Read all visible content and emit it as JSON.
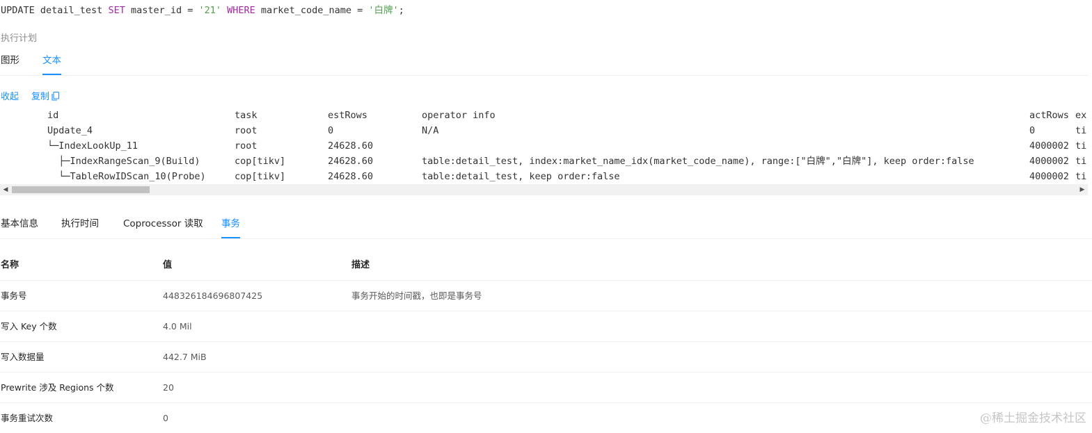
{
  "sql": {
    "p1": "UPDATE detail_test ",
    "kw_set": "SET",
    "p2": " master_id = ",
    "s1": "'21'",
    "p3": " ",
    "kw_where": "WHERE",
    "p4": " market_code_name = ",
    "s2": "'白牌'",
    "p5": ";"
  },
  "plan_section_label": "执行计划",
  "view_tabs": [
    {
      "label": "图形",
      "active": false
    },
    {
      "label": "文本",
      "active": true
    }
  ],
  "actions": {
    "collapse": "收起",
    "copy": "复制",
    "copy_icon": "copy-icon"
  },
  "plan": {
    "columns": [
      "id",
      "task",
      "estRows",
      "operator info",
      "actRows",
      "ex"
    ],
    "rows": [
      {
        "id": "Update_4",
        "task": "root",
        "estRows": "0",
        "info": "N/A",
        "actRows": "0",
        "ex": "ti"
      },
      {
        "id": "└─IndexLookUp_11",
        "task": "root",
        "estRows": "24628.60",
        "info": "",
        "actRows": "4000002",
        "ex": "ti"
      },
      {
        "id": "  ├─IndexRangeScan_9(Build)",
        "task": "cop[tikv]",
        "estRows": "24628.60",
        "info": "table:detail_test, index:market_name_idx(market_code_name), range:[\"白牌\",\"白牌\"], keep order:false",
        "actRows": "4000002",
        "ex": "ti"
      },
      {
        "id": "  └─TableRowIDScan_10(Probe)",
        "task": "cop[tikv]",
        "estRows": "24628.60",
        "info": "table:detail_test, keep order:false",
        "actRows": "4000002",
        "ex": "ti"
      }
    ]
  },
  "scrollbar": {
    "left_arrow": "◀",
    "right_arrow": "▶"
  },
  "detail_tabs": [
    {
      "label": "基本信息",
      "active": false
    },
    {
      "label": "执行时间",
      "active": false
    },
    {
      "label": "Coprocessor 读取",
      "active": false
    },
    {
      "label": "事务",
      "active": true
    }
  ],
  "info_table": {
    "headers": [
      "名称",
      "值",
      "描述"
    ],
    "rows": [
      {
        "name": "事务号",
        "value": "448326184696807425",
        "desc": "事务开始的时间戳，也即是事务号"
      },
      {
        "name": "写入 Key 个数",
        "value": "4.0 Mil",
        "desc": ""
      },
      {
        "name": "写入数据量",
        "value": "442.7 MiB",
        "desc": ""
      },
      {
        "name": "Prewrite 涉及 Regions 个数",
        "value": "20",
        "desc": ""
      },
      {
        "name": "事务重试次数",
        "value": "0",
        "desc": ""
      }
    ]
  },
  "watermark": "@稀土掘金技术社区",
  "colors": {
    "accent": "#1890ff",
    "keyword": "#a626a4",
    "string": "#50a14f"
  }
}
